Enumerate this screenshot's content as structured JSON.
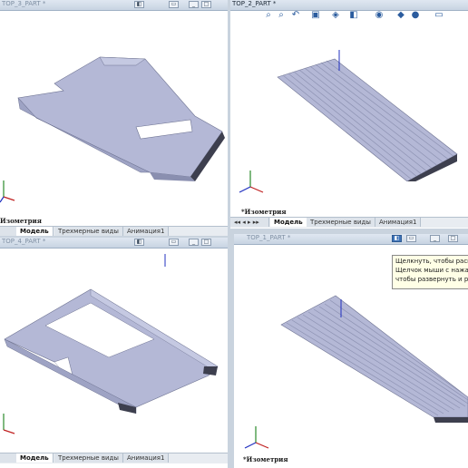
{
  "panes": {
    "top_left": {
      "title": "TOP_3_PART *",
      "view_label": "Изометрия"
    },
    "top_right": {
      "title": "TOP_2_PART *",
      "view_label": "*Изометрия"
    },
    "bottom_left": {
      "title": "TOP_4_PART *",
      "view_label": ""
    },
    "bottom_right": {
      "title": "TOP_1_PART *",
      "view_label": "*Изометрия"
    }
  },
  "tabs": {
    "model": "Модель",
    "views3d": "Трехмерные виды",
    "animation": "Анимация1"
  },
  "tooltip": {
    "line1": "Щелкнуть, чтобы распо",
    "line2": "Щелчок мыши с нажат",
    "line3": "чтобы развернуть и рас"
  },
  "toolbar_icons": [
    "zoom-to-fit-icon",
    "zoom-area-icon",
    "previous-view-icon",
    "section-view-icon",
    "view-orientation-icon",
    "display-style-icon",
    "hide-show-icon",
    "edit-appearance-icon",
    "apply-scene-icon",
    "view-settings-icon"
  ],
  "colors": {
    "part": "#b4b8d6",
    "part_dark": "#7d829e",
    "accent": "#3e73b8"
  }
}
